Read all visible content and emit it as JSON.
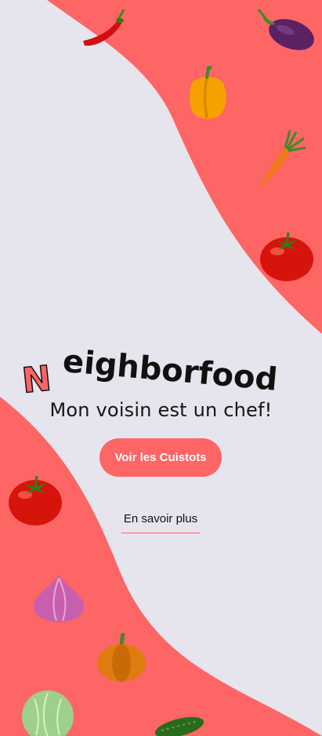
{
  "app": {
    "brand_initial": "N",
    "brand_rest": "eighborfood",
    "tagline": "Mon voisin est un chef!",
    "cta_label": "Voir les Cuistots",
    "secondary_link": "En savoir plus"
  },
  "colors": {
    "accent": "#fe6565",
    "background": "#e6e5ee",
    "text": "#141414"
  },
  "decorations": [
    "chili-pepper-icon",
    "eggplant-icon",
    "bell-pepper-icon",
    "carrot-icon",
    "tomato-icon",
    "tomato-icon",
    "onion-icon",
    "pumpkin-icon",
    "cabbage-icon",
    "cucumber-icon"
  ]
}
